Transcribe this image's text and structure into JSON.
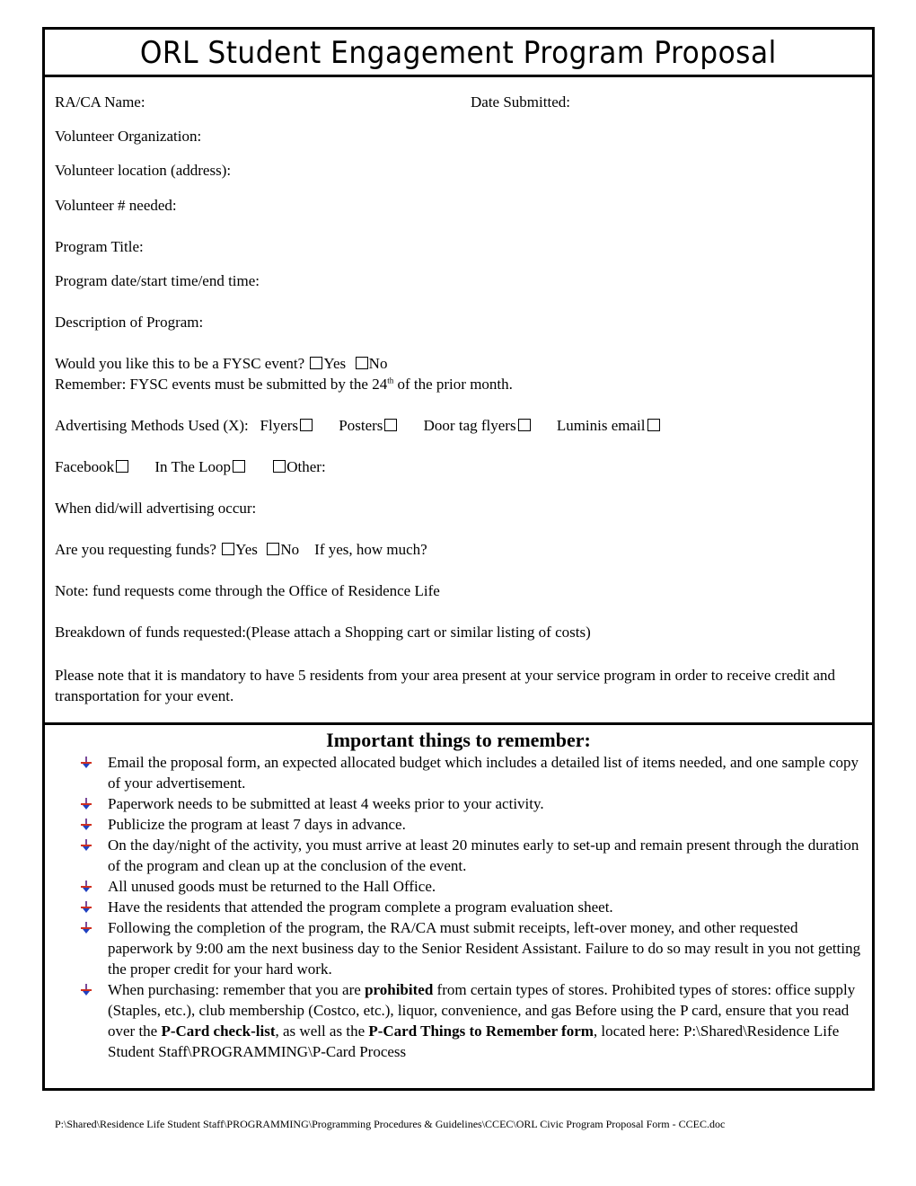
{
  "title": "ORL Student Engagement Program Proposal",
  "form": {
    "ra_ca_name": "RA/CA Name:",
    "date_submitted": "Date Submitted:",
    "volunteer_organization": "Volunteer Organization:",
    "volunteer_location": "Volunteer location (address):",
    "volunteer_needed": "Volunteer # needed:",
    "program_title": "Program Title:",
    "program_datetime": "Program date/start time/end time:",
    "description": "Description of Program:",
    "fysc_question": "Would you like this to be a FYSC event?",
    "fysc_yes": "Yes",
    "fysc_no": "No",
    "fysc_reminder_pre": "Remember: FYSC events must be submitted by the 24",
    "fysc_reminder_sup": "th",
    "fysc_reminder_post": " of the prior month.",
    "advertising_label": "Advertising Methods Used (X):",
    "ad_flyers": "Flyers",
    "ad_posters": "Posters",
    "ad_door_tag": "Door tag flyers",
    "ad_luminis": "Luminis email",
    "ad_facebook": "Facebook",
    "ad_in_the_loop": "In The Loop",
    "ad_other": "Other:",
    "advertising_when": "When did/will advertising occur:",
    "funds_question": "Are you requesting funds?",
    "funds_yes": "Yes",
    "funds_no": "No",
    "funds_how_much": "If yes, how much?",
    "funds_note": "Note: fund requests come through the Office of Residence Life",
    "funds_breakdown": "Breakdown of funds requested:(Please attach a Shopping cart or similar listing of costs)",
    "mandatory_note": "Please note that it is mandatory to have 5 residents from your area present at your service program in order to receive credit and transportation for your event."
  },
  "notes": {
    "heading": "Important things to remember:",
    "items": [
      {
        "text": "Email the proposal form, an expected allocated budget which includes a detailed list of items needed, and one sample copy of your advertisement."
      },
      {
        "text": "Paperwork needs to be submitted at least 4 weeks prior to your activity."
      },
      {
        "text": "Publicize the program at least 7 days in advance."
      },
      {
        "text": "On the day/night of the activity, you must arrive at least 20 minutes early to set-up and remain present through the duration of the program and clean up at the conclusion of the event."
      },
      {
        "text": "All unused goods must be returned to the Hall Office."
      },
      {
        "text": "Have the residents that attended the program complete a program evaluation sheet."
      },
      {
        "text": "Following the completion of the program, the RA/CA must submit receipts, left-over money, and other requested paperwork by 9:00 am the next business day to the Senior Resident Assistant.  Failure to do so may result in you not getting the proper credit for your hard work."
      }
    ],
    "purchasing": {
      "p1": "When purchasing: remember that you are ",
      "b1": "prohibited",
      "p2": " from certain types of stores. Prohibited types of stores: office supply (Staples, etc.), club membership (Costco, etc.), liquor, convenience, and gas Before using the P card, ensure that you read over the ",
      "b2": "P-Card check-list",
      "p3": ", as well as the ",
      "b3": "P-Card Things to Remember form",
      "p4": ", located here: P:\\Shared\\Residence Life Student Staff\\PROGRAMMING\\P-Card Process"
    }
  },
  "footer": "P:\\Shared\\Residence Life Student Staff\\PROGRAMMING\\Programming Procedures & Guidelines\\CCEC\\ORL Civic Program Proposal Form - CCEC.doc"
}
